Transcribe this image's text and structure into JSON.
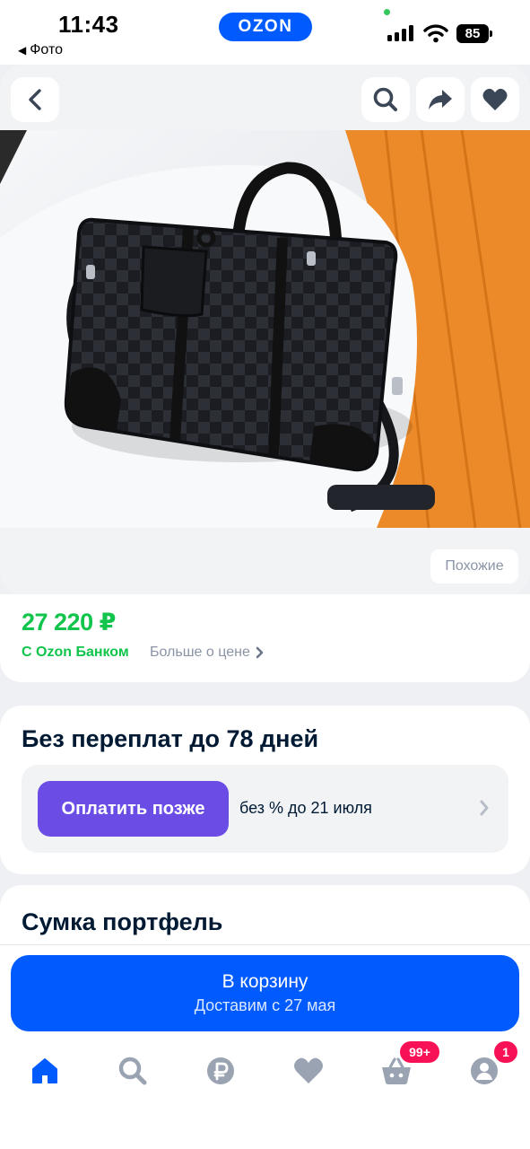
{
  "status_bar": {
    "time": "11:43",
    "back_app": "Фото",
    "brand": "OZON",
    "battery": "85"
  },
  "gallery": {
    "similar_label": "Похожие"
  },
  "price": {
    "value": "27 220 ₽",
    "bank_label": "С Ozon Банком",
    "more_label": "Больше о цене"
  },
  "installments": {
    "title": "Без переплат до 78 дней",
    "button_label": "Оплатить позже",
    "info": "без % до 21 июля"
  },
  "product": {
    "title": "Сумка портфель"
  },
  "cart": {
    "label": "В корзину",
    "delivery": "Доставим с 27 мая"
  },
  "tabbar": {
    "cart_badge": "99+",
    "profile_badge": "1"
  },
  "colors": {
    "brand_blue": "#005bff",
    "price_green": "#10c44c",
    "pay_later_purple": "#6b4de6",
    "badge_pink": "#f91155"
  }
}
